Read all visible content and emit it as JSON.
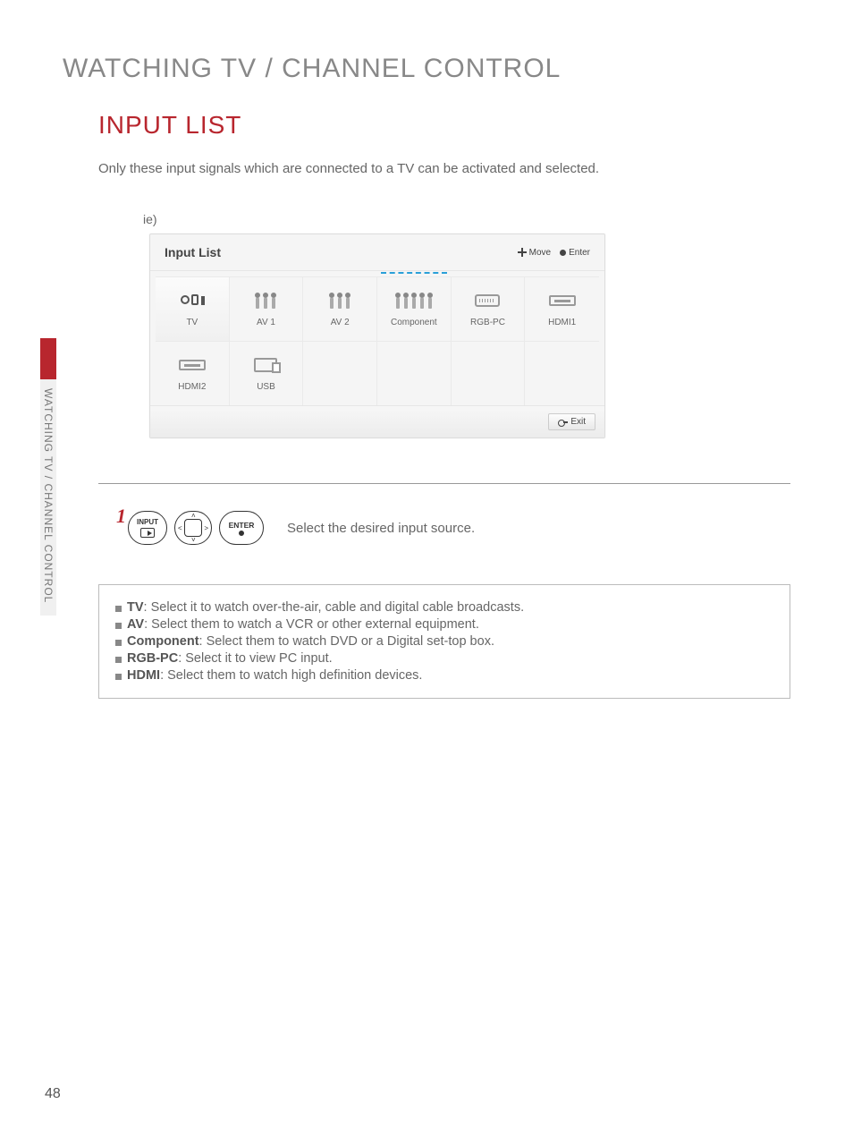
{
  "page_number": "48",
  "side_tab": "WATCHING TV / CHANNEL CONTROL",
  "chapter_title": "WATCHING TV / CHANNEL CONTROL",
  "section_title": "INPUT LIST",
  "intro": "Only these input signals which are connected to a TV can be activated and selected.",
  "example_label": "ie)",
  "panel": {
    "title": "Input List",
    "hint_move": "Move",
    "hint_enter": "Enter",
    "exit": "Exit",
    "items": [
      {
        "label": "TV",
        "icon": "tv"
      },
      {
        "label": "AV 1",
        "icon": "rca3"
      },
      {
        "label": "AV 2",
        "icon": "rca3"
      },
      {
        "label": "Component",
        "icon": "rca5",
        "highlight": true
      },
      {
        "label": "RGB-PC",
        "icon": "vga"
      },
      {
        "label": "HDMI1",
        "icon": "hdmi"
      },
      {
        "label": "HDMI2",
        "icon": "hdmi"
      },
      {
        "label": "USB",
        "icon": "usb"
      }
    ]
  },
  "step": {
    "num": "1",
    "btn_input": "INPUT",
    "btn_enter": "ENTER",
    "text": "Select the desired input source."
  },
  "desc": {
    "rows": [
      {
        "term": "TV",
        "text": ": Select it to watch over-the-air, cable and digital cable broadcasts."
      },
      {
        "term": "AV",
        "text": ": Select them to watch a VCR or other external equipment."
      },
      {
        "term": "Component",
        "text": ": Select them to watch DVD or a Digital set-top box."
      },
      {
        "term": "RGB-PC",
        "text": ": Select it to view PC input."
      },
      {
        "term": "HDMI",
        "text": ": Select them to watch high definition devices."
      }
    ]
  }
}
